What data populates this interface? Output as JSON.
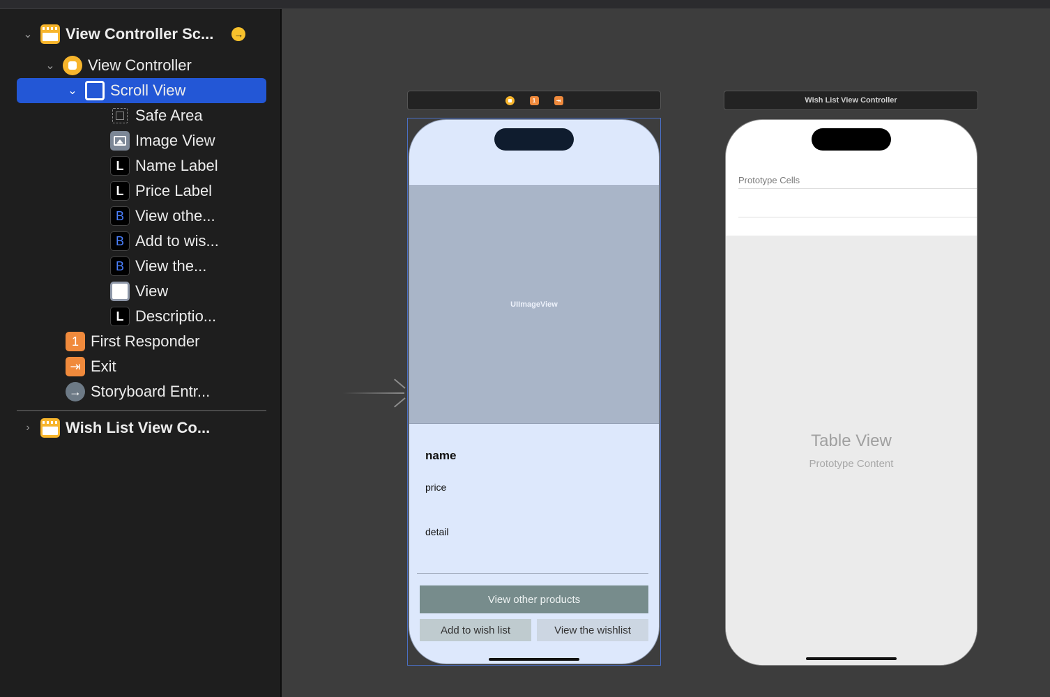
{
  "outline": {
    "items": [
      {
        "label": "View Controller Sc...",
        "icon": "storyboard-scene-icon",
        "bold": true
      },
      {
        "label": "View Controller",
        "icon": "view-controller-icon"
      },
      {
        "label": "Scroll View",
        "icon": "scroll-view-icon",
        "selected": true
      },
      {
        "label": "Safe Area",
        "icon": "safe-area-icon"
      },
      {
        "label": "Image View",
        "icon": "image-view-icon"
      },
      {
        "label": "Name Label",
        "icon": "label-icon",
        "glyph": "L"
      },
      {
        "label": "Price Label",
        "icon": "label-icon",
        "glyph": "L"
      },
      {
        "label": "View othe...",
        "icon": "button-icon",
        "glyph": "B"
      },
      {
        "label": "Add to wis...",
        "icon": "button-icon",
        "glyph": "B"
      },
      {
        "label": "View the...",
        "icon": "button-icon",
        "glyph": "B"
      },
      {
        "label": "View",
        "icon": "view-icon"
      },
      {
        "label": "Descriptio...",
        "icon": "label-icon",
        "glyph": "L"
      },
      {
        "label": "First Responder",
        "icon": "first-responder-icon",
        "glyph": "1"
      },
      {
        "label": "Exit",
        "icon": "exit-icon"
      },
      {
        "label": "Storyboard Entr...",
        "icon": "storyboard-entry-icon"
      },
      {
        "label": "Wish List View Co...",
        "icon": "storyboard-scene-icon",
        "bold": true
      }
    ]
  },
  "scene1": {
    "image_view_label": "UIImageView",
    "name": "name",
    "price": "price",
    "detail": "detail",
    "btn_other": "View other products",
    "btn_add": "Add to wish list",
    "btn_view": "View the wishlist",
    "dock_first_glyph": "1"
  },
  "scene2": {
    "title": "Wish List View Controller",
    "prototype_cells": "Prototype Cells",
    "table_title": "Table View",
    "table_subtitle": "Prototype Content"
  },
  "colors": {
    "selection": "#2357d6",
    "scene_icon": "#f7b52c",
    "responder_icon": "#f08a3c",
    "canvas": "#3d3d3d",
    "phone1_bg": "#dde8fc",
    "image_view_bg": "#a9b5c8",
    "primary_button": "#778c8c"
  }
}
